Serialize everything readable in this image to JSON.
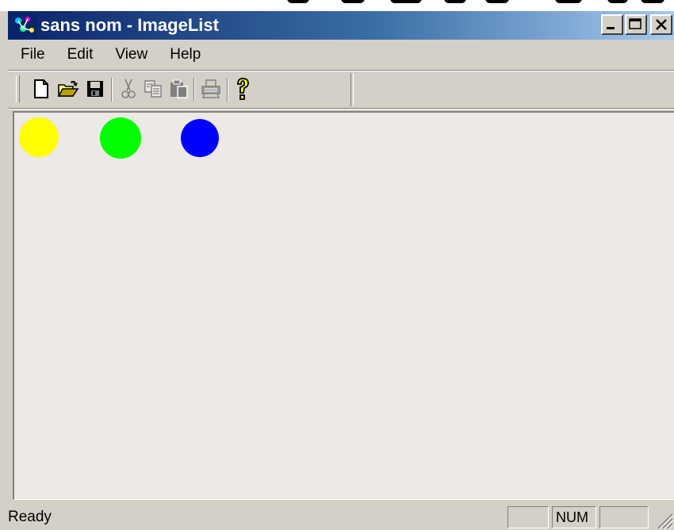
{
  "window": {
    "title": "sans nom - ImageList",
    "icon": "app-icon",
    "controls": [
      {
        "name": "minimize",
        "icon": "minimize-icon"
      },
      {
        "name": "maximize",
        "icon": "maximize-icon"
      },
      {
        "name": "close",
        "icon": "close-icon"
      }
    ]
  },
  "menu": {
    "items": [
      "File",
      "Edit",
      "View",
      "Help"
    ]
  },
  "toolbar": {
    "buttons": [
      {
        "name": "new",
        "icon": "new-document-icon",
        "enabled": true
      },
      {
        "name": "open",
        "icon": "open-folder-icon",
        "enabled": true
      },
      {
        "name": "save",
        "icon": "save-disk-icon",
        "enabled": true
      },
      {
        "name": "cut",
        "icon": "scissors-icon",
        "enabled": false
      },
      {
        "name": "copy",
        "icon": "copy-icon",
        "enabled": false
      },
      {
        "name": "paste",
        "icon": "paste-icon",
        "enabled": false
      },
      {
        "name": "print",
        "icon": "printer-icon",
        "enabled": false
      },
      {
        "name": "about",
        "icon": "help-question-icon",
        "enabled": true
      }
    ]
  },
  "content": {
    "circles": [
      {
        "color": "#ffff00"
      },
      {
        "color": "#00ff00"
      },
      {
        "color": "#0000ff"
      }
    ]
  },
  "statusbar": {
    "text": "Ready",
    "indicators": [
      "",
      "NUM",
      ""
    ]
  },
  "colors": {
    "title_gradient_start": "#0a246a",
    "title_gradient_end": "#a6caf0",
    "face": "#d4d0c8",
    "client": "#ece9e6"
  }
}
